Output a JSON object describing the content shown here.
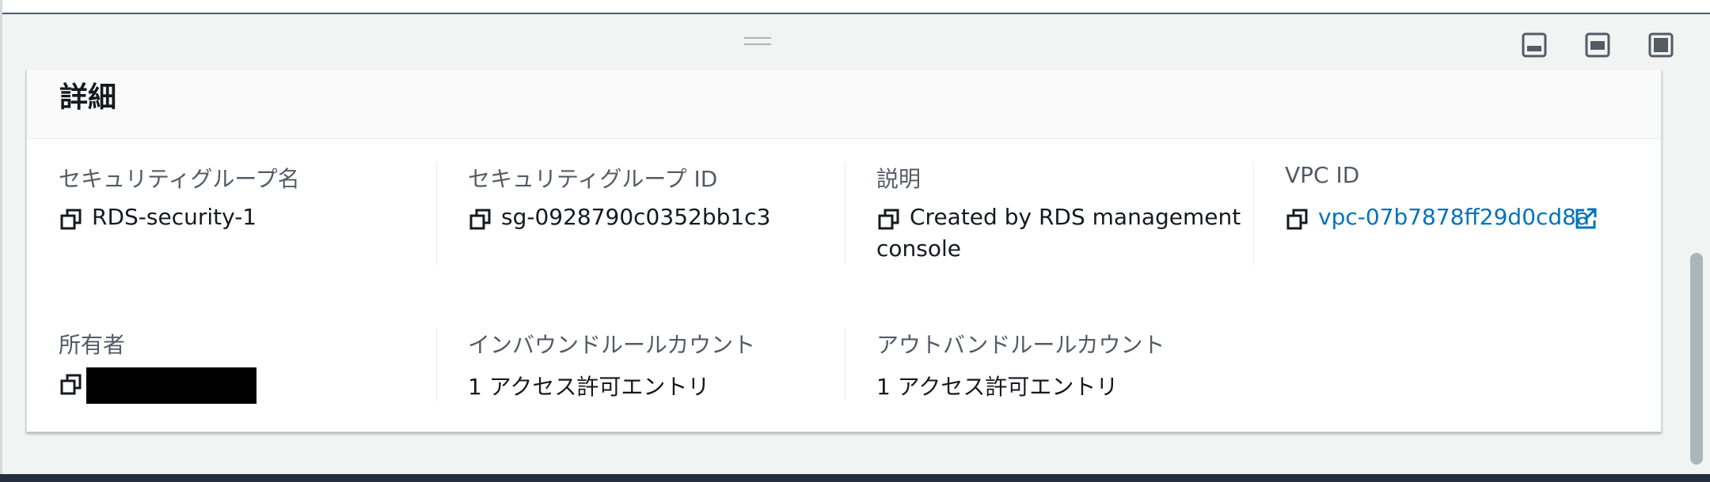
{
  "details": {
    "title": "詳細",
    "fields": {
      "sg_name": {
        "label": "セキュリティグループ名",
        "value": "RDS-security-1"
      },
      "sg_id": {
        "label": "セキュリティグループ ID",
        "value": "sg-0928790c0352bb1c3"
      },
      "description": {
        "label": "説明",
        "value_line1": "Created by RDS management",
        "value_line2": "console"
      },
      "vpc_id": {
        "label": "VPC ID",
        "value": "vpc-07b7878ff29d0cd8a"
      },
      "owner": {
        "label": "所有者",
        "value": ""
      },
      "inbound": {
        "label": "インバウンドルールカウント",
        "value": "1 アクセス許可エントリ"
      },
      "outbound": {
        "label": "アウトバンドルールカウント",
        "value": "1 アクセス許可エントリ"
      }
    }
  },
  "icons": {
    "copy": "copy-icon",
    "external_link": "external-link-icon",
    "layout_buttons": [
      "panel-bottom-icon",
      "panel-split-icon",
      "panel-full-icon"
    ]
  },
  "colors": {
    "link": "#0073bb",
    "label": "#545b64",
    "text": "#16191f"
  }
}
